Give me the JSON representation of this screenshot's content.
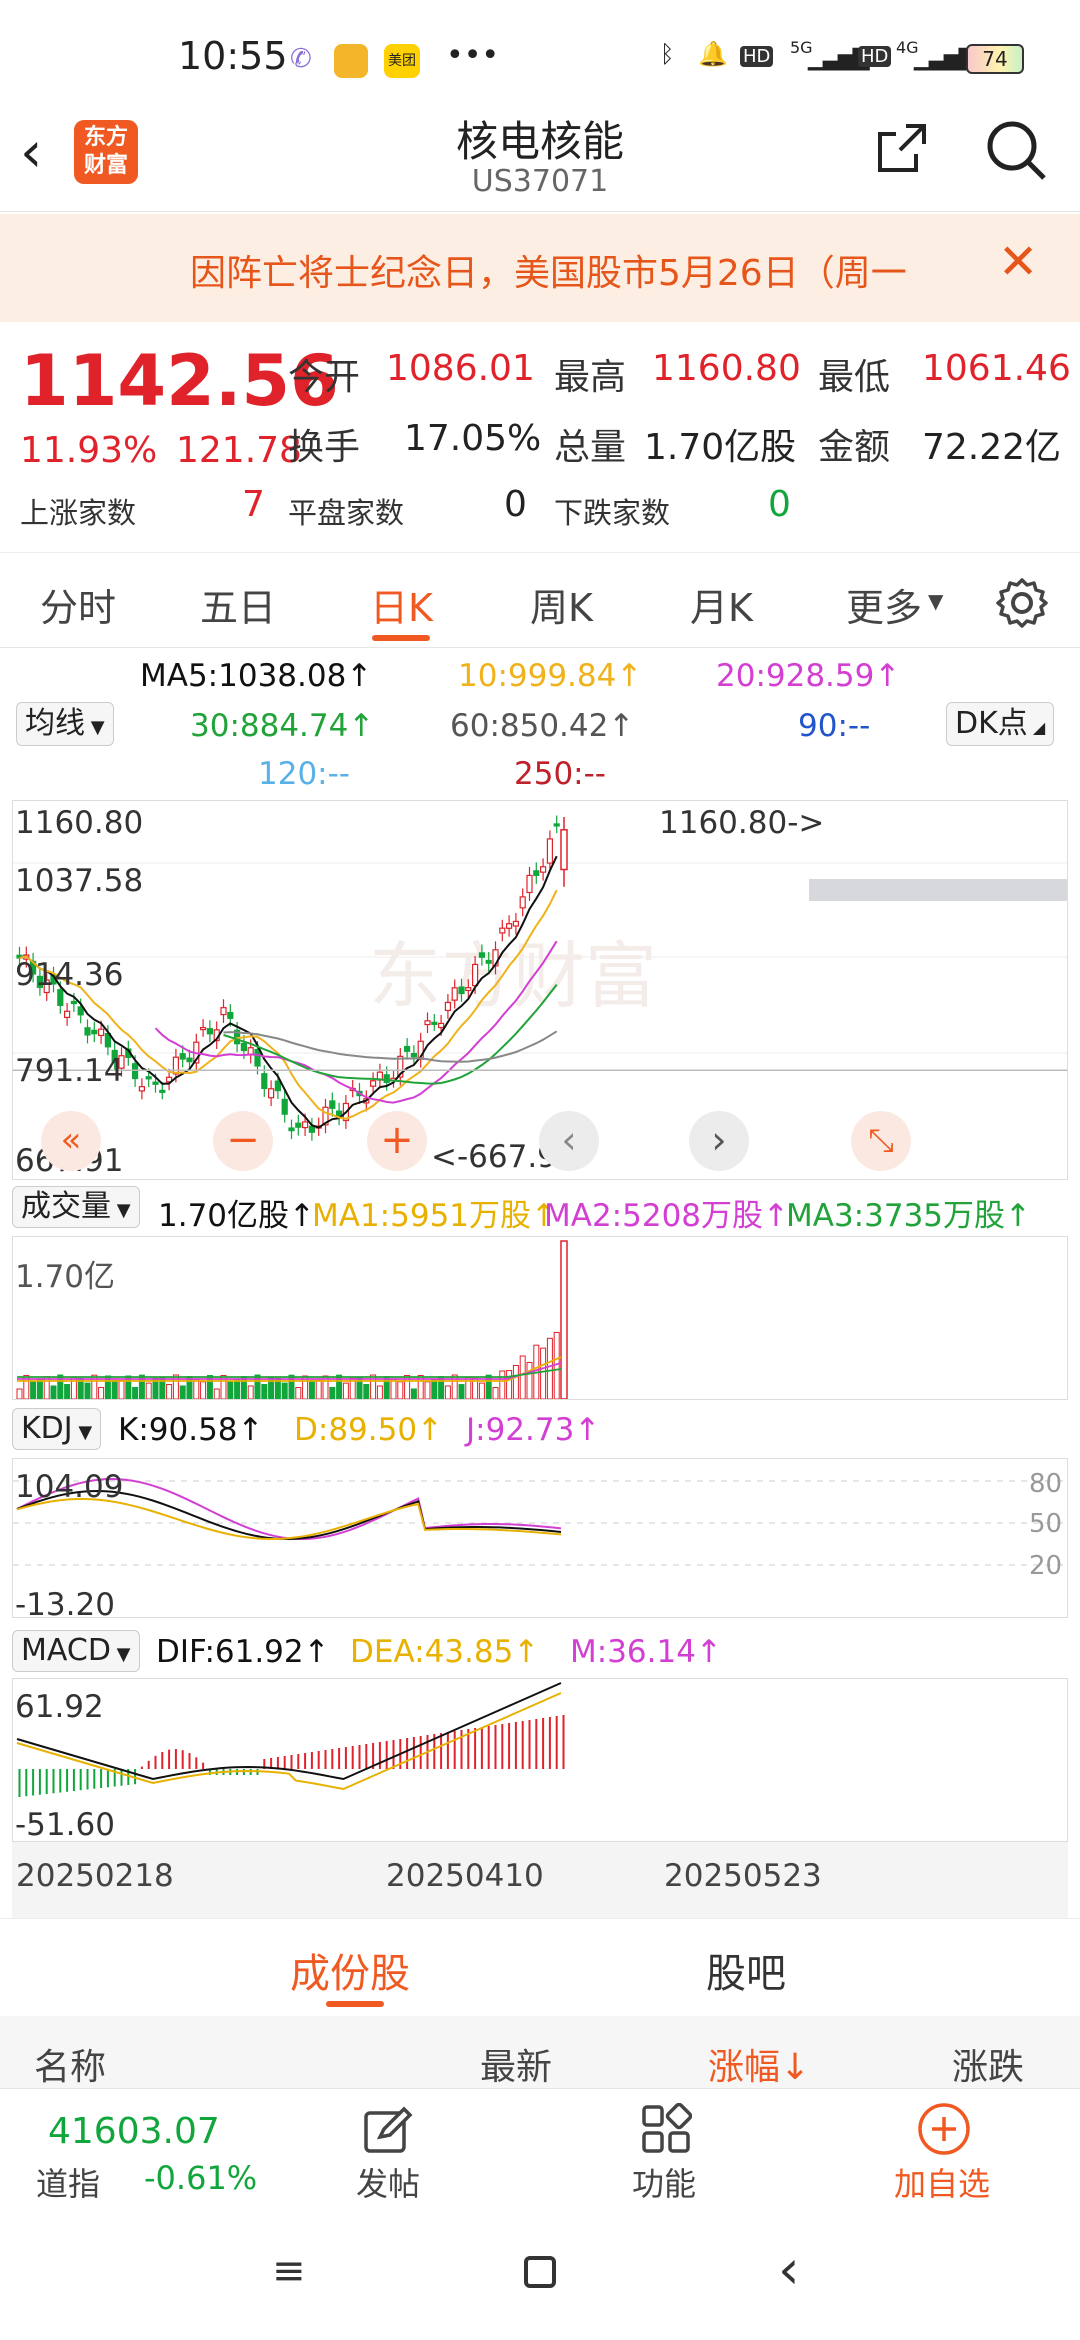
{
  "status_bar": {
    "time": "10:55",
    "battery": "74",
    "network1": "5G",
    "network2": "4G",
    "hd": "HD"
  },
  "header": {
    "title": "核电核能",
    "code": "US37071",
    "logo_text": "东方财富"
  },
  "notice": {
    "text": "因阵亡将士纪念日，美国股市5月26日（周一"
  },
  "quote": {
    "price": "1142.56",
    "change_pct": "11.93%",
    "change_abs": "121.78",
    "open_label": "今开",
    "open": "1086.01",
    "high_label": "最高",
    "high": "1160.80",
    "low_label": "最低",
    "low": "1061.46",
    "turnover_label": "换手",
    "turnover": "17.05%",
    "volume_label": "总量",
    "volume": "1.70亿股",
    "amount_label": "金额",
    "amount": "72.22亿",
    "up_label": "上涨家数",
    "up_count": "7",
    "flat_label": "平盘家数",
    "flat_count": "0",
    "down_label": "下跌家数",
    "down_count": "0"
  },
  "tabs": [
    {
      "label": "分时"
    },
    {
      "label": "五日"
    },
    {
      "label": "日K"
    },
    {
      "label": "周K"
    },
    {
      "label": "月K"
    },
    {
      "label": "更多"
    }
  ],
  "ma_legend": {
    "selector": "均线",
    "dk": "DK点",
    "ma5": "MA5:1038.08↑",
    "ma10": "10:999.84↑",
    "ma20": "20:928.59↑",
    "ma30": "30:884.74↑",
    "ma60": "60:850.42↑",
    "ma90": "90:--",
    "ma120": "120:--",
    "ma250": "250:--"
  },
  "colors": {
    "up": "#e0222a",
    "down": "#11a63b",
    "accent": "#f05a22",
    "ma5": "#111111",
    "ma10": "#f0b21a",
    "ma20": "#d23fd2",
    "ma30": "#22a33a",
    "ma60": "#888888",
    "ma90": "#2255cc",
    "ma120": "#5ab0e8",
    "ma250": "#c0202a"
  },
  "kline": {
    "y_labels": [
      "1160.80",
      "1037.58",
      "914.36",
      "791.14",
      "667.91"
    ],
    "high_mark": "1160.80->",
    "low_mark": "<-667.91",
    "watermark": "东方财富"
  },
  "volume": {
    "selector": "成交量",
    "value": "1.70亿股↑",
    "ma1": "MA1:5951万股↑",
    "ma2": "MA2:5208万股↑",
    "ma3": "MA3:3735万股↑",
    "y_label": "1.70亿"
  },
  "kdj": {
    "selector": "KDJ",
    "k": "K:90.58↑",
    "d": "D:89.50↑",
    "j": "J:92.73↑",
    "y_top": "104.09",
    "y_bottom": "-13.20",
    "levels": [
      "80",
      "50",
      "20"
    ]
  },
  "macd": {
    "selector": "MACD",
    "dif": "DIF:61.92↑",
    "dea": "DEA:43.85↑",
    "m": "M:36.14↑",
    "y_top": "61.92",
    "y_bottom": "-51.60"
  },
  "dates": [
    "20250218",
    "20250410",
    "20250523"
  ],
  "subtabs": [
    {
      "label": "成份股"
    },
    {
      "label": "股吧"
    }
  ],
  "columns": {
    "name": "名称",
    "latest": "最新",
    "pct": "涨幅↓",
    "chg": "涨跌"
  },
  "bottom_bar": {
    "index_value": "41603.07",
    "index_name": "道指",
    "index_pct": "-0.61%",
    "post": "发帖",
    "func": "功能",
    "add": "加自选"
  }
}
